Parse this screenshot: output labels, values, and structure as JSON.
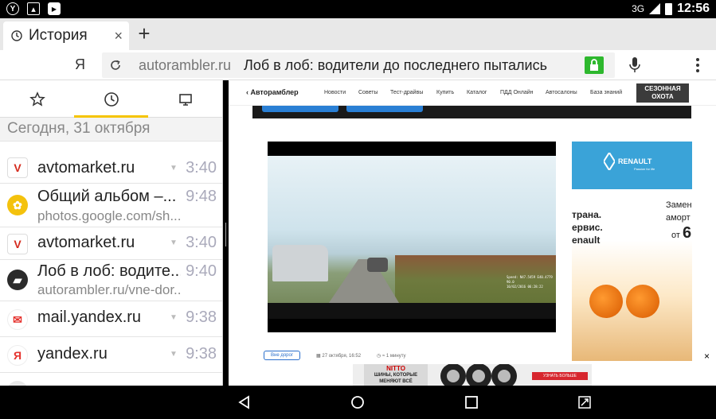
{
  "status_bar": {
    "left_icons": [
      "yandex-icon",
      "image-icon",
      "youtube-icon"
    ],
    "network": "3G",
    "time": "12:56"
  },
  "tab_strip": {
    "tab_title": "История",
    "close_glyph": "×",
    "new_tab_glyph": "+"
  },
  "omnibar": {
    "ya_label": "Я",
    "url_host": "autorambler.ru",
    "url_title": "Лоб в лоб: водители до последнего пытались"
  },
  "history_panel": {
    "tabs": [
      "bookmarks-star-icon",
      "history-clock-icon",
      "devices-monitor-icon"
    ],
    "active_tab": "history-clock-icon",
    "date_header": "Сегодня, 31 октября",
    "items": [
      {
        "title": "avtomarket.ru",
        "url": "",
        "time": "3:40",
        "favicon": "avtomarket-icon",
        "has_arrow": true
      },
      {
        "title": "Общий альбом –...",
        "url": "photos.google.com/sh...",
        "time": "9:48",
        "favicon": "google-photos-icon",
        "has_arrow": false
      },
      {
        "title": "avtomarket.ru",
        "url": "",
        "time": "3:40",
        "favicon": "avtomarket-icon",
        "has_arrow": true
      },
      {
        "title": "Лоб в лоб: водите...",
        "url": "autorambler.ru/vne-dor...",
        "time": "9:40",
        "favicon": "autorambler-icon",
        "has_arrow": false
      },
      {
        "title": "mail.yandex.ru",
        "url": "",
        "time": "9:38",
        "favicon": "yandex-mail-icon",
        "has_arrow": true
      },
      {
        "title": "yandex.ru",
        "url": "",
        "time": "9:38",
        "favicon": "yandex-icon",
        "has_arrow": true
      }
    ]
  },
  "webpage": {
    "logo": "‹ Авторамблер",
    "nav_items": [
      "Новости",
      "Советы",
      "Тест-драйвы",
      "Купить",
      "Каталог",
      "ПДД Онлайн",
      "Автосалоны",
      "База знаний"
    ],
    "promo": "СЕЗОННАЯ ОХОТА",
    "video_osd": [
      "Speed: N47.5459 E40.4779",
      "90.0",
      "10/02/2016 06:28:22"
    ],
    "ad": {
      "brand": "RENAULT",
      "tagline": "Passion for life",
      "left_text": [
        "трана.",
        "ервис.",
        "enault"
      ],
      "right_text": [
        "Замен",
        "аморт"
      ],
      "price_prefix": "от",
      "price_digit": "6"
    },
    "meta": {
      "tag": "Вне дорог",
      "date": "27 октября, 16:52",
      "read_time": "≈ 1 минуту"
    },
    "banner": {
      "brand": "NITTO",
      "text": "ШИНЫ, КОТОРЫЕ МЕНЯЮТ ВСЁ",
      "cta": "УЗНАТЬ БОЛЬШЕ"
    },
    "ad_close": "×"
  },
  "nav_bar": {
    "buttons": [
      "back-icon",
      "home-icon",
      "recents-icon",
      "screenshot-icon"
    ]
  }
}
